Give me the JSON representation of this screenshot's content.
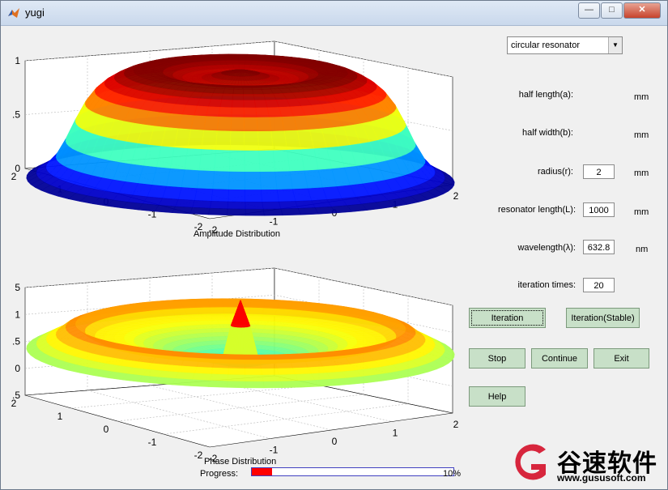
{
  "window": {
    "title": "yugi",
    "minimize": "—",
    "maximize": "□",
    "close": "✕"
  },
  "app_icon": "matlab-logo-icon",
  "resonator_type": {
    "selected": "circular  resonator"
  },
  "params": {
    "half_length": {
      "label": "half length(a):",
      "unit": "mm"
    },
    "half_width": {
      "label": "half  width(b):",
      "unit": "mm"
    },
    "radius": {
      "label": "radius(r):",
      "value": "2",
      "unit": "mm"
    },
    "resonator_length": {
      "label": "resonator length(L):",
      "value": "1000",
      "unit": "mm"
    },
    "wavelength": {
      "label": "wavelength(λ):",
      "value": "632.8",
      "unit": "nm"
    },
    "iterations": {
      "label": "iteration times:",
      "value": "20"
    }
  },
  "buttons": {
    "iteration": "Iteration",
    "iteration_stable": "Iteration(Stable)",
    "stop": "Stop",
    "continue": "Continue",
    "exit": "Exit",
    "help": "Help"
  },
  "plots": {
    "amplitude": {
      "caption": "Amplitude Distribution",
      "z_ticks": [
        "1",
        ".5",
        "0"
      ],
      "x_ticks": [
        "2",
        "1",
        "0",
        "-1",
        "-2"
      ],
      "y_ticks": [
        "-2",
        "-1",
        "0",
        "1",
        "2"
      ],
      "colormap": "jet"
    },
    "phase": {
      "caption": "Phase Distribution",
      "z_ticks": [
        "5",
        "1",
        ".5",
        "0",
        ".5"
      ],
      "x_ticks": [
        "2",
        "1",
        "0",
        "-1",
        "-2"
      ],
      "y_ticks": [
        "-2",
        "-1",
        "0",
        "1",
        "2"
      ],
      "colormap": "jet"
    }
  },
  "progress": {
    "label": "Progress:",
    "value": 0.1,
    "text": "10%",
    "fill_color": "#ff0000",
    "border_color": "#4040c0"
  },
  "watermark": {
    "brand": "谷速软件",
    "url": "www.gususoft.com",
    "accent": "#d7263d"
  },
  "colors": {
    "button_bg": "#c8e0c8",
    "window_bg": "#f0f0f0"
  }
}
